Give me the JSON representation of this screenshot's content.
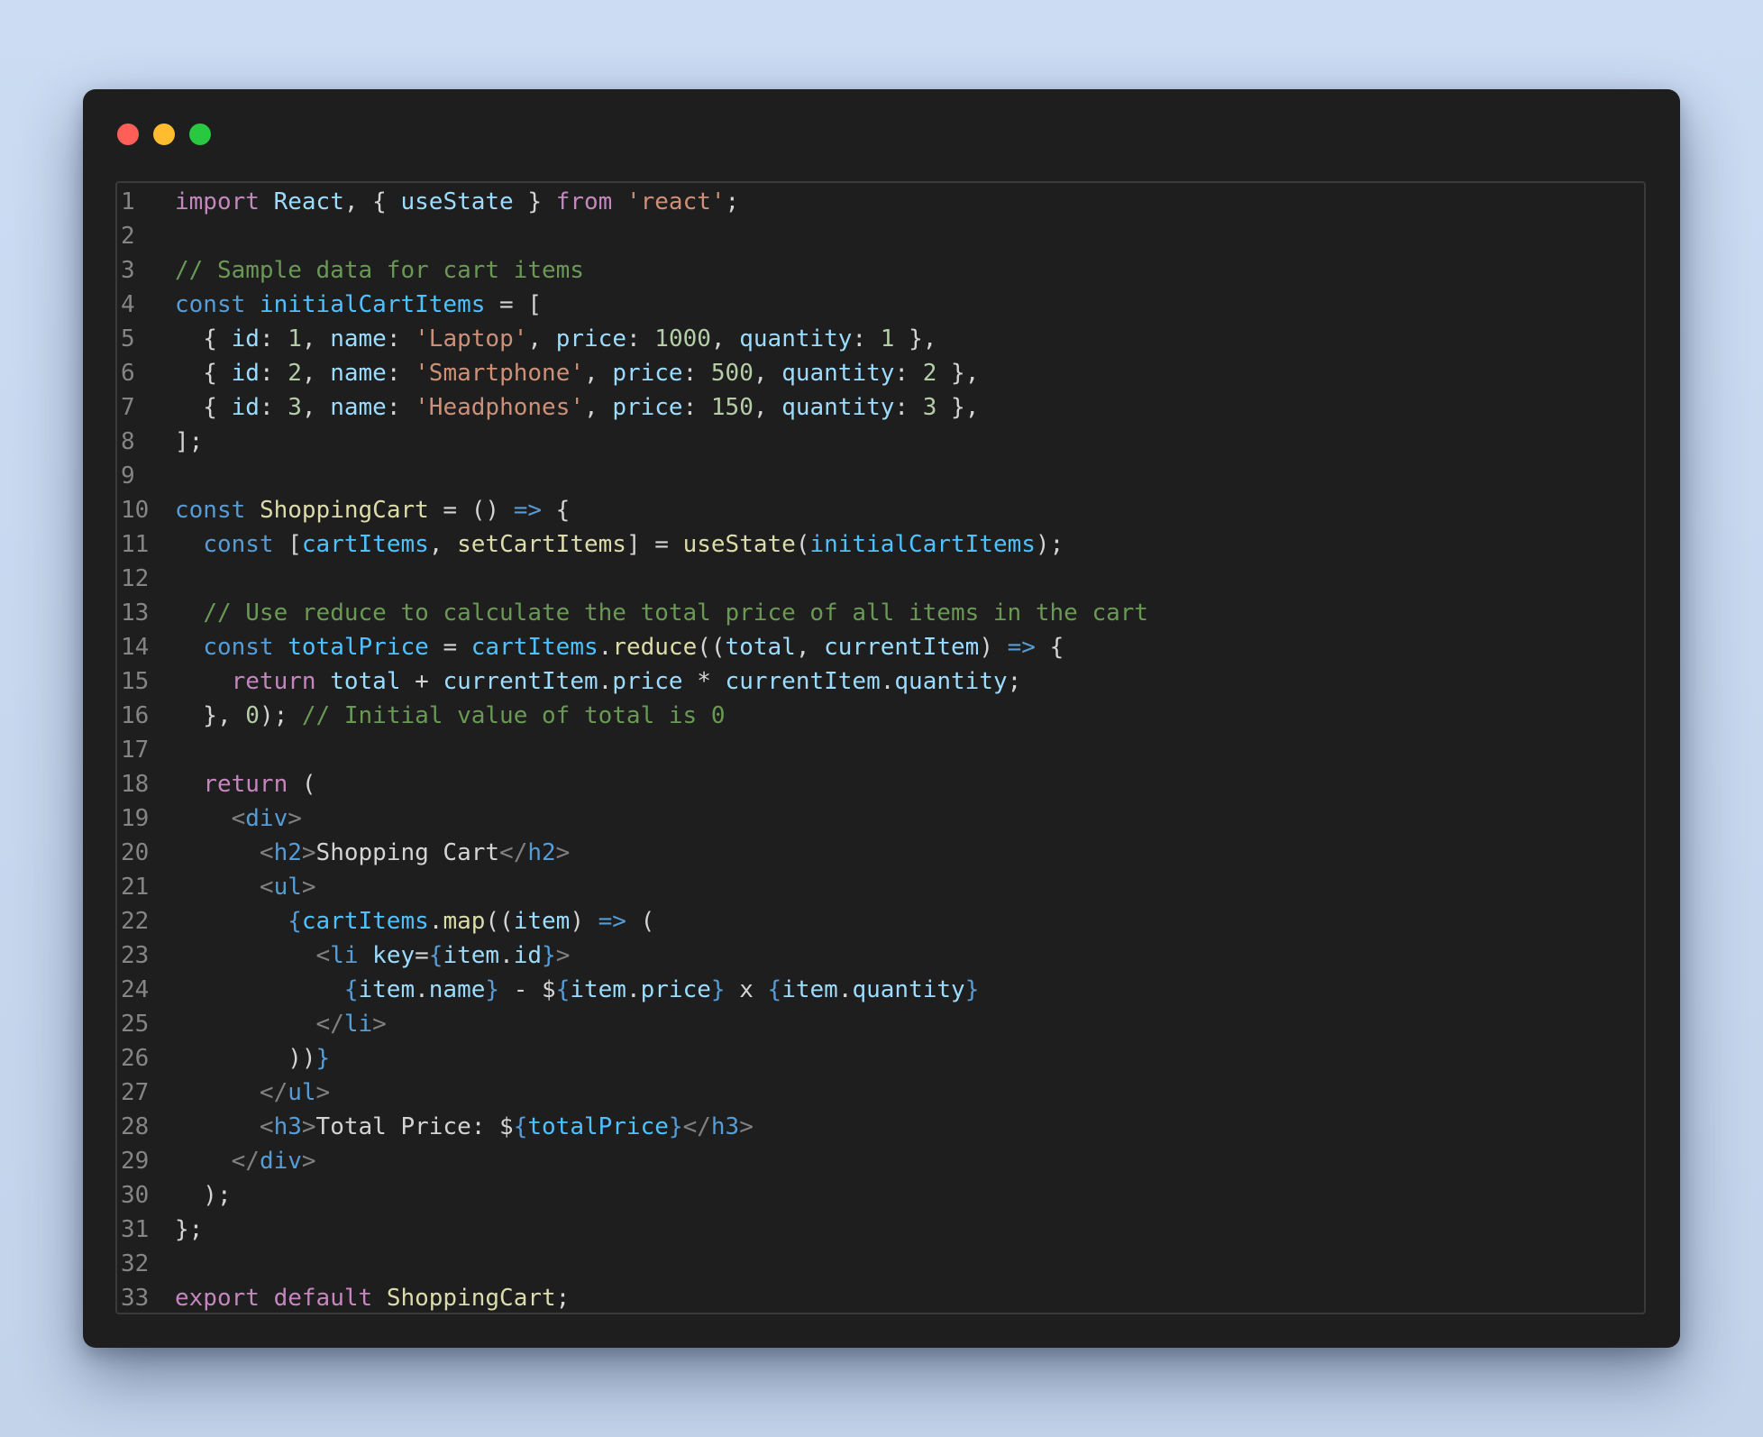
{
  "window": {
    "controls": [
      "close",
      "minimize",
      "maximize"
    ],
    "colors": {
      "close": "#ff5f57",
      "minimize": "#febc2e",
      "maximize": "#28c840",
      "background": "#1e1e1e"
    }
  },
  "editor": {
    "language": "javascript",
    "lines": [
      {
        "n": "1",
        "tokens": [
          [
            "kc",
            "import"
          ],
          [
            "pl",
            " "
          ],
          [
            "vr",
            "React"
          ],
          [
            "pl",
            ", { "
          ],
          [
            "vr",
            "useState"
          ],
          [
            "pl",
            " } "
          ],
          [
            "kc",
            "from"
          ],
          [
            "pl",
            " "
          ],
          [
            "st",
            "'react'"
          ],
          [
            "pl",
            ";"
          ]
        ]
      },
      {
        "n": "2",
        "tokens": []
      },
      {
        "n": "3",
        "tokens": [
          [
            "cm",
            "// Sample data for cart items"
          ]
        ]
      },
      {
        "n": "4",
        "tokens": [
          [
            "kw",
            "const"
          ],
          [
            "pl",
            " "
          ],
          [
            "cn",
            "initialCartItems"
          ],
          [
            "pl",
            " = ["
          ]
        ]
      },
      {
        "n": "5",
        "tokens": [
          [
            "pl",
            "  { "
          ],
          [
            "vr",
            "id"
          ],
          [
            "pl",
            ": "
          ],
          [
            "nm",
            "1"
          ],
          [
            "pl",
            ", "
          ],
          [
            "vr",
            "name"
          ],
          [
            "pl",
            ": "
          ],
          [
            "st",
            "'Laptop'"
          ],
          [
            "pl",
            ", "
          ],
          [
            "vr",
            "price"
          ],
          [
            "pl",
            ": "
          ],
          [
            "nm",
            "1000"
          ],
          [
            "pl",
            ", "
          ],
          [
            "vr",
            "quantity"
          ],
          [
            "pl",
            ": "
          ],
          [
            "nm",
            "1"
          ],
          [
            "pl",
            " },"
          ]
        ]
      },
      {
        "n": "6",
        "tokens": [
          [
            "pl",
            "  { "
          ],
          [
            "vr",
            "id"
          ],
          [
            "pl",
            ": "
          ],
          [
            "nm",
            "2"
          ],
          [
            "pl",
            ", "
          ],
          [
            "vr",
            "name"
          ],
          [
            "pl",
            ": "
          ],
          [
            "st",
            "'Smartphone'"
          ],
          [
            "pl",
            ", "
          ],
          [
            "vr",
            "price"
          ],
          [
            "pl",
            ": "
          ],
          [
            "nm",
            "500"
          ],
          [
            "pl",
            ", "
          ],
          [
            "vr",
            "quantity"
          ],
          [
            "pl",
            ": "
          ],
          [
            "nm",
            "2"
          ],
          [
            "pl",
            " },"
          ]
        ]
      },
      {
        "n": "7",
        "tokens": [
          [
            "pl",
            "  { "
          ],
          [
            "vr",
            "id"
          ],
          [
            "pl",
            ": "
          ],
          [
            "nm",
            "3"
          ],
          [
            "pl",
            ", "
          ],
          [
            "vr",
            "name"
          ],
          [
            "pl",
            ": "
          ],
          [
            "st",
            "'Headphones'"
          ],
          [
            "pl",
            ", "
          ],
          [
            "vr",
            "price"
          ],
          [
            "pl",
            ": "
          ],
          [
            "nm",
            "150"
          ],
          [
            "pl",
            ", "
          ],
          [
            "vr",
            "quantity"
          ],
          [
            "pl",
            ": "
          ],
          [
            "nm",
            "3"
          ],
          [
            "pl",
            " },"
          ]
        ]
      },
      {
        "n": "8",
        "tokens": [
          [
            "pl",
            "];"
          ]
        ]
      },
      {
        "n": "9",
        "tokens": []
      },
      {
        "n": "10",
        "tokens": [
          [
            "kw",
            "const"
          ],
          [
            "pl",
            " "
          ],
          [
            "fn",
            "ShoppingCart"
          ],
          [
            "pl",
            " = () "
          ],
          [
            "kw",
            "=>"
          ],
          [
            "pl",
            " {"
          ]
        ]
      },
      {
        "n": "11",
        "tokens": [
          [
            "pl",
            "  "
          ],
          [
            "kw",
            "const"
          ],
          [
            "pl",
            " ["
          ],
          [
            "cn",
            "cartItems"
          ],
          [
            "pl",
            ", "
          ],
          [
            "fn",
            "setCartItems"
          ],
          [
            "pl",
            "] = "
          ],
          [
            "fn",
            "useState"
          ],
          [
            "pl",
            "("
          ],
          [
            "cn",
            "initialCartItems"
          ],
          [
            "pl",
            ");"
          ]
        ]
      },
      {
        "n": "12",
        "tokens": []
      },
      {
        "n": "13",
        "tokens": [
          [
            "pl",
            "  "
          ],
          [
            "cm",
            "// Use reduce to calculate the total price of all items in the cart"
          ]
        ]
      },
      {
        "n": "14",
        "tokens": [
          [
            "pl",
            "  "
          ],
          [
            "kw",
            "const"
          ],
          [
            "pl",
            " "
          ],
          [
            "cn",
            "totalPrice"
          ],
          [
            "pl",
            " = "
          ],
          [
            "cn",
            "cartItems"
          ],
          [
            "pl",
            "."
          ],
          [
            "fn",
            "reduce"
          ],
          [
            "pl",
            "(("
          ],
          [
            "vr",
            "total"
          ],
          [
            "pl",
            ", "
          ],
          [
            "vr",
            "currentItem"
          ],
          [
            "pl",
            ") "
          ],
          [
            "kw",
            "=>"
          ],
          [
            "pl",
            " {"
          ]
        ]
      },
      {
        "n": "15",
        "tokens": [
          [
            "pl",
            "    "
          ],
          [
            "kc",
            "return"
          ],
          [
            "pl",
            " "
          ],
          [
            "vr",
            "total"
          ],
          [
            "pl",
            " + "
          ],
          [
            "vr",
            "currentItem"
          ],
          [
            "pl",
            "."
          ],
          [
            "vr",
            "price"
          ],
          [
            "pl",
            " * "
          ],
          [
            "vr",
            "currentItem"
          ],
          [
            "pl",
            "."
          ],
          [
            "vr",
            "quantity"
          ],
          [
            "pl",
            ";"
          ]
        ]
      },
      {
        "n": "16",
        "tokens": [
          [
            "pl",
            "  }, "
          ],
          [
            "nm",
            "0"
          ],
          [
            "pl",
            "); "
          ],
          [
            "cm",
            "// Initial value of total is 0"
          ]
        ]
      },
      {
        "n": "17",
        "tokens": []
      },
      {
        "n": "18",
        "tokens": [
          [
            "pl",
            "  "
          ],
          [
            "kc",
            "return"
          ],
          [
            "pl",
            " ("
          ]
        ]
      },
      {
        "n": "19",
        "tokens": [
          [
            "pl",
            "    "
          ],
          [
            "br",
            "<"
          ],
          [
            "tg",
            "div"
          ],
          [
            "br",
            ">"
          ]
        ]
      },
      {
        "n": "20",
        "tokens": [
          [
            "pl",
            "      "
          ],
          [
            "br",
            "<"
          ],
          [
            "tg",
            "h2"
          ],
          [
            "br",
            ">"
          ],
          [
            "pl",
            "Shopping Cart"
          ],
          [
            "br",
            "</"
          ],
          [
            "tg",
            "h2"
          ],
          [
            "br",
            ">"
          ]
        ]
      },
      {
        "n": "21",
        "tokens": [
          [
            "pl",
            "      "
          ],
          [
            "br",
            "<"
          ],
          [
            "tg",
            "ul"
          ],
          [
            "br",
            ">"
          ]
        ]
      },
      {
        "n": "22",
        "tokens": [
          [
            "pl",
            "        "
          ],
          [
            "kw",
            "{"
          ],
          [
            "cn",
            "cartItems"
          ],
          [
            "pl",
            "."
          ],
          [
            "fn",
            "map"
          ],
          [
            "pl",
            "(("
          ],
          [
            "vr",
            "item"
          ],
          [
            "pl",
            ") "
          ],
          [
            "kw",
            "=>"
          ],
          [
            "pl",
            " ("
          ]
        ]
      },
      {
        "n": "23",
        "tokens": [
          [
            "pl",
            "          "
          ],
          [
            "br",
            "<"
          ],
          [
            "tg",
            "li"
          ],
          [
            "pl",
            " "
          ],
          [
            "vr",
            "key"
          ],
          [
            "pl",
            "="
          ],
          [
            "kw",
            "{"
          ],
          [
            "vr",
            "item"
          ],
          [
            "pl",
            "."
          ],
          [
            "vr",
            "id"
          ],
          [
            "kw",
            "}"
          ],
          [
            "br",
            ">"
          ]
        ]
      },
      {
        "n": "24",
        "tokens": [
          [
            "pl",
            "            "
          ],
          [
            "kw",
            "{"
          ],
          [
            "vr",
            "item"
          ],
          [
            "pl",
            "."
          ],
          [
            "vr",
            "name"
          ],
          [
            "kw",
            "}"
          ],
          [
            "pl",
            " - $"
          ],
          [
            "kw",
            "{"
          ],
          [
            "vr",
            "item"
          ],
          [
            "pl",
            "."
          ],
          [
            "vr",
            "price"
          ],
          [
            "kw",
            "}"
          ],
          [
            "pl",
            " x "
          ],
          [
            "kw",
            "{"
          ],
          [
            "vr",
            "item"
          ],
          [
            "pl",
            "."
          ],
          [
            "vr",
            "quantity"
          ],
          [
            "kw",
            "}"
          ]
        ]
      },
      {
        "n": "25",
        "tokens": [
          [
            "pl",
            "          "
          ],
          [
            "br",
            "</"
          ],
          [
            "tg",
            "li"
          ],
          [
            "br",
            ">"
          ]
        ]
      },
      {
        "n": "26",
        "tokens": [
          [
            "pl",
            "        ))"
          ],
          [
            "kw",
            "}"
          ]
        ]
      },
      {
        "n": "27",
        "tokens": [
          [
            "pl",
            "      "
          ],
          [
            "br",
            "</"
          ],
          [
            "tg",
            "ul"
          ],
          [
            "br",
            ">"
          ]
        ]
      },
      {
        "n": "28",
        "tokens": [
          [
            "pl",
            "      "
          ],
          [
            "br",
            "<"
          ],
          [
            "tg",
            "h3"
          ],
          [
            "br",
            ">"
          ],
          [
            "pl",
            "Total Price: $"
          ],
          [
            "kw",
            "{"
          ],
          [
            "cn",
            "totalPrice"
          ],
          [
            "kw",
            "}"
          ],
          [
            "br",
            "</"
          ],
          [
            "tg",
            "h3"
          ],
          [
            "br",
            ">"
          ]
        ]
      },
      {
        "n": "29",
        "tokens": [
          [
            "pl",
            "    "
          ],
          [
            "br",
            "</"
          ],
          [
            "tg",
            "div"
          ],
          [
            "br",
            ">"
          ]
        ]
      },
      {
        "n": "30",
        "tokens": [
          [
            "pl",
            "  );"
          ]
        ]
      },
      {
        "n": "31",
        "tokens": [
          [
            "pl",
            "};"
          ]
        ]
      },
      {
        "n": "32",
        "tokens": []
      },
      {
        "n": "33",
        "tokens": [
          [
            "kc",
            "export"
          ],
          [
            "pl",
            " "
          ],
          [
            "kc",
            "default"
          ],
          [
            "pl",
            " "
          ],
          [
            "fn",
            "ShoppingCart"
          ],
          [
            "pl",
            ";"
          ]
        ]
      }
    ]
  }
}
